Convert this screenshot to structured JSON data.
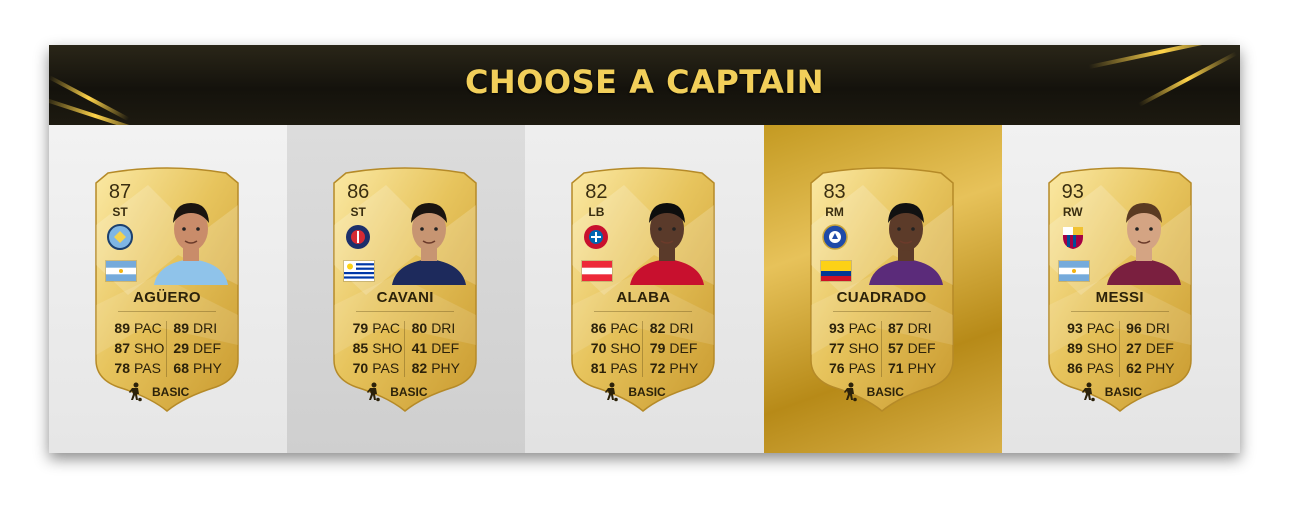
{
  "title": "CHOOSE A CAPTAIN",
  "colors": {
    "gold": "#f2cf5a",
    "card_gold": "#e8c560",
    "selected_column": "#d6ad3c"
  },
  "selected_index": 3,
  "chemistry_icon": "player-silhouette-icon",
  "players": [
    {
      "rating": "87",
      "position": "ST",
      "name": "AGÜERO",
      "club_icon": "man-city-crest-icon",
      "flag_icon": "argentina-flag-icon",
      "stats": [
        [
          "89",
          "PAC"
        ],
        [
          "89",
          "DRI"
        ],
        [
          "87",
          "SHO"
        ],
        [
          "29",
          "DEF"
        ],
        [
          "78",
          "PAS"
        ],
        [
          "68",
          "PHY"
        ]
      ],
      "chemistry": "BASIC"
    },
    {
      "rating": "86",
      "position": "ST",
      "name": "CAVANI",
      "club_icon": "psg-crest-icon",
      "flag_icon": "uruguay-flag-icon",
      "stats": [
        [
          "79",
          "PAC"
        ],
        [
          "80",
          "DRI"
        ],
        [
          "85",
          "SHO"
        ],
        [
          "41",
          "DEF"
        ],
        [
          "70",
          "PAS"
        ],
        [
          "82",
          "PHY"
        ]
      ],
      "chemistry": "BASIC"
    },
    {
      "rating": "82",
      "position": "LB",
      "name": "ALABA",
      "club_icon": "bayern-crest-icon",
      "flag_icon": "austria-flag-icon",
      "stats": [
        [
          "86",
          "PAC"
        ],
        [
          "82",
          "DRI"
        ],
        [
          "70",
          "SHO"
        ],
        [
          "79",
          "DEF"
        ],
        [
          "81",
          "PAS"
        ],
        [
          "72",
          "PHY"
        ]
      ],
      "chemistry": "BASIC"
    },
    {
      "rating": "83",
      "position": "RM",
      "name": "CUADRADO",
      "club_icon": "chelsea-crest-icon",
      "flag_icon": "colombia-flag-icon",
      "stats": [
        [
          "93",
          "PAC"
        ],
        [
          "87",
          "DRI"
        ],
        [
          "77",
          "SHO"
        ],
        [
          "57",
          "DEF"
        ],
        [
          "76",
          "PAS"
        ],
        [
          "71",
          "PHY"
        ]
      ],
      "chemistry": "BASIC"
    },
    {
      "rating": "93",
      "position": "RW",
      "name": "MESSI",
      "club_icon": "barcelona-crest-icon",
      "flag_icon": "argentina-flag-icon",
      "stats": [
        [
          "93",
          "PAC"
        ],
        [
          "96",
          "DRI"
        ],
        [
          "89",
          "SHO"
        ],
        [
          "27",
          "DEF"
        ],
        [
          "86",
          "PAS"
        ],
        [
          "62",
          "PHY"
        ]
      ],
      "chemistry": "BASIC"
    }
  ]
}
